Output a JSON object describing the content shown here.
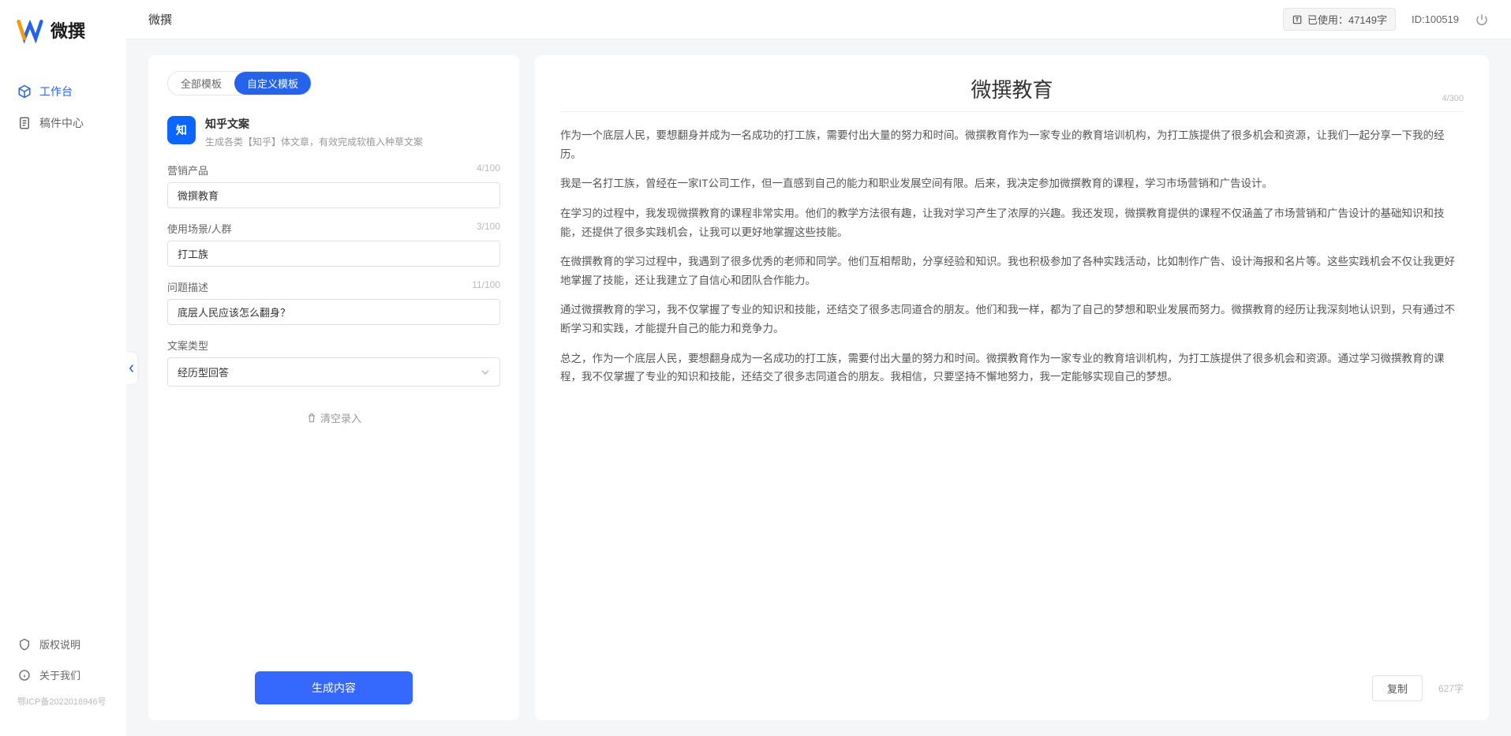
{
  "app_name": "微撰",
  "topbar": {
    "title": "微撰",
    "usage_label": "已使用：",
    "usage_value": "47149字",
    "user_id": "ID:100519"
  },
  "sidebar": {
    "nav": [
      {
        "label": "工作台",
        "active": true
      },
      {
        "label": "稿件中心",
        "active": false
      }
    ],
    "footer": [
      {
        "label": "版权说明"
      },
      {
        "label": "关于我们"
      }
    ],
    "icp": "鄂ICP备2022016946号"
  },
  "left": {
    "tabs": [
      {
        "label": "全部模板",
        "active": false
      },
      {
        "label": "自定义模板",
        "active": true
      }
    ],
    "template": {
      "icon_text": "知",
      "title": "知乎文案",
      "desc": "生成各类【知乎】体文章，有效完成软植入种草文案"
    },
    "fields": {
      "product": {
        "label": "营销产品",
        "value": "微撰教育",
        "counter": "4/100"
      },
      "scene": {
        "label": "使用场景/人群",
        "value": "打工族",
        "counter": "3/100"
      },
      "problem": {
        "label": "问题描述",
        "value": "底层人民应该怎么翻身？",
        "counter": "11/100"
      },
      "type": {
        "label": "文案类型",
        "value": "经历型回答"
      }
    },
    "clear_label": "清空录入",
    "generate_label": "生成内容"
  },
  "right": {
    "title": "微撰教育",
    "title_counter": "4/300",
    "paragraphs": [
      "作为一个底层人民，要想翻身并成为一名成功的打工族，需要付出大量的努力和时间。微撰教育作为一家专业的教育培训机构，为打工族提供了很多机会和资源，让我们一起分享一下我的经历。",
      "我是一名打工族，曾经在一家IT公司工作，但一直感到自己的能力和职业发展空间有限。后来，我决定参加微撰教育的课程，学习市场营销和广告设计。",
      "在学习的过程中，我发现微撰教育的课程非常实用。他们的教学方法很有趣，让我对学习产生了浓厚的兴趣。我还发现，微撰教育提供的课程不仅涵盖了市场营销和广告设计的基础知识和技能，还提供了很多实践机会，让我可以更好地掌握这些技能。",
      "在微撰教育的学习过程中，我遇到了很多优秀的老师和同学。他们互相帮助，分享经验和知识。我也积极参加了各种实践活动，比如制作广告、设计海报和名片等。这些实践机会不仅让我更好地掌握了技能，还让我建立了自信心和团队合作能力。",
      "通过微撰教育的学习，我不仅掌握了专业的知识和技能，还结交了很多志同道合的朋友。他们和我一样，都为了自己的梦想和职业发展而努力。微撰教育的经历让我深刻地认识到，只有通过不断学习和实践，才能提升自己的能力和竞争力。",
      "总之，作为一个底层人民，要想翻身成为一名成功的打工族，需要付出大量的努力和时间。微撰教育作为一家专业的教育培训机构，为打工族提供了很多机会和资源。通过学习微撰教育的课程，我不仅掌握了专业的知识和技能，还结交了很多志同道合的朋友。我相信，只要坚持不懈地努力，我一定能够实现自己的梦想。"
    ],
    "copy_label": "复制",
    "char_count": "627字"
  }
}
